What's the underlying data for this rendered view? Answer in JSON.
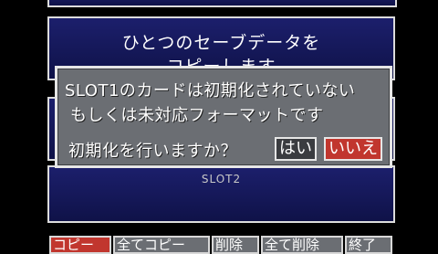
{
  "title": {
    "line1": "ひとつのセーブデータを",
    "line2": "コピーします"
  },
  "dialog": {
    "line1": "SLOT1のカードは初期化されていない",
    "line2": "もしくは未対応フォーマットです",
    "question": "初期化を行いますか？",
    "yes_label": "はい",
    "no_label": "いいえ"
  },
  "slot2": {
    "label": "SLOT2"
  },
  "bottom_menu": [
    {
      "label": "コピー"
    },
    {
      "label": "全てコピー"
    },
    {
      "label": "削除"
    },
    {
      "label": "全て削除"
    },
    {
      "label": "終了"
    }
  ],
  "colors": {
    "panel_blue": "#1c1f6c",
    "dialog_gray": "#6b6e73",
    "selected_red": "#c1362e"
  }
}
